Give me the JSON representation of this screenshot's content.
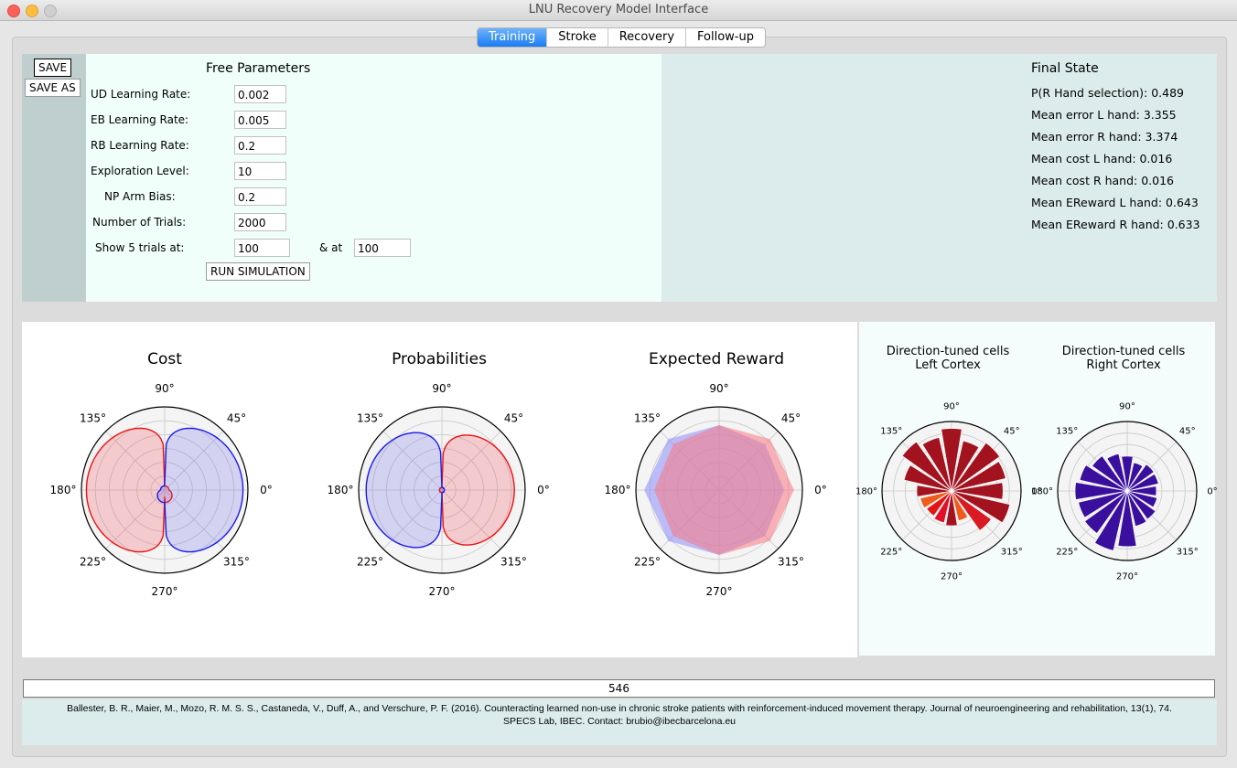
{
  "window": {
    "title": "LNU Recovery Model Interface"
  },
  "tabs": [
    {
      "label": "Training",
      "active": true
    },
    {
      "label": "Stroke",
      "active": false
    },
    {
      "label": "Recovery",
      "active": false
    },
    {
      "label": "Follow-up",
      "active": false
    }
  ],
  "buttons": {
    "save": "SAVE",
    "save_as": "SAVE AS",
    "run": "RUN SIMULATION"
  },
  "params": {
    "title": "Free Parameters",
    "ud_label": "UD Learning Rate:",
    "ud_value": "0.002",
    "eb_label": "EB Learning Rate:",
    "eb_value": "0.005",
    "rb_label": "RB Learning Rate:",
    "rb_value": "0.2",
    "expl_label": "Exploration Level:",
    "expl_value": "10",
    "np_label": "NP Arm Bias:",
    "np_value": "0.2",
    "trials_label": "Number of Trials:",
    "trials_value": "2000",
    "show_label": "Show 5 trials at:",
    "show_value1": "100",
    "and_label": "& at",
    "show_value2": "100"
  },
  "final_state": {
    "title": "Final State",
    "lines": [
      "P(R Hand selection): 0.489",
      "Mean error L hand: 3.355",
      "Mean error R hand: 3.374",
      "Mean cost L hand: 0.016",
      "Mean cost R hand: 0.016",
      "Mean EReward L hand: 0.643",
      "Mean EReward R hand: 0.633"
    ]
  },
  "polar_labels": {
    "a0": "0°",
    "a45": "45°",
    "a90": "90°",
    "a135": "135°",
    "a180": "180°",
    "a225": "225°",
    "a270": "270°",
    "a315": "315°"
  },
  "plots": {
    "cost_title": "Cost",
    "prob_title": "Probabilities",
    "reward_title": "Expected Reward",
    "left_cells_title_1": "Direction-tuned cells",
    "left_cells_title_2": "Left Cortex",
    "right_cells_title_1": "Direction-tuned cells",
    "right_cells_title_2": "Right Cortex"
  },
  "colors": {
    "left": "#ee1111",
    "right": "#1a1aee",
    "left_cells": "#a3121f",
    "right_cells": "#3a0f9e"
  },
  "progress": {
    "value": "546"
  },
  "citation": {
    "line1": "Ballester, B. R., Maier, M., Mozo, R. M. S. S., Castaneda, V., Duff, A., and Verschure, P. F. (2016). Counteracting learned non-use in chronic stroke patients with reinforcement-induced movement therapy. Journal of neuroengineering and rehabilitation, 13(1), 74.",
    "line2": "SPECS Lab, IBEC. Contact: brubio@ibecbarcelona.eu"
  }
}
